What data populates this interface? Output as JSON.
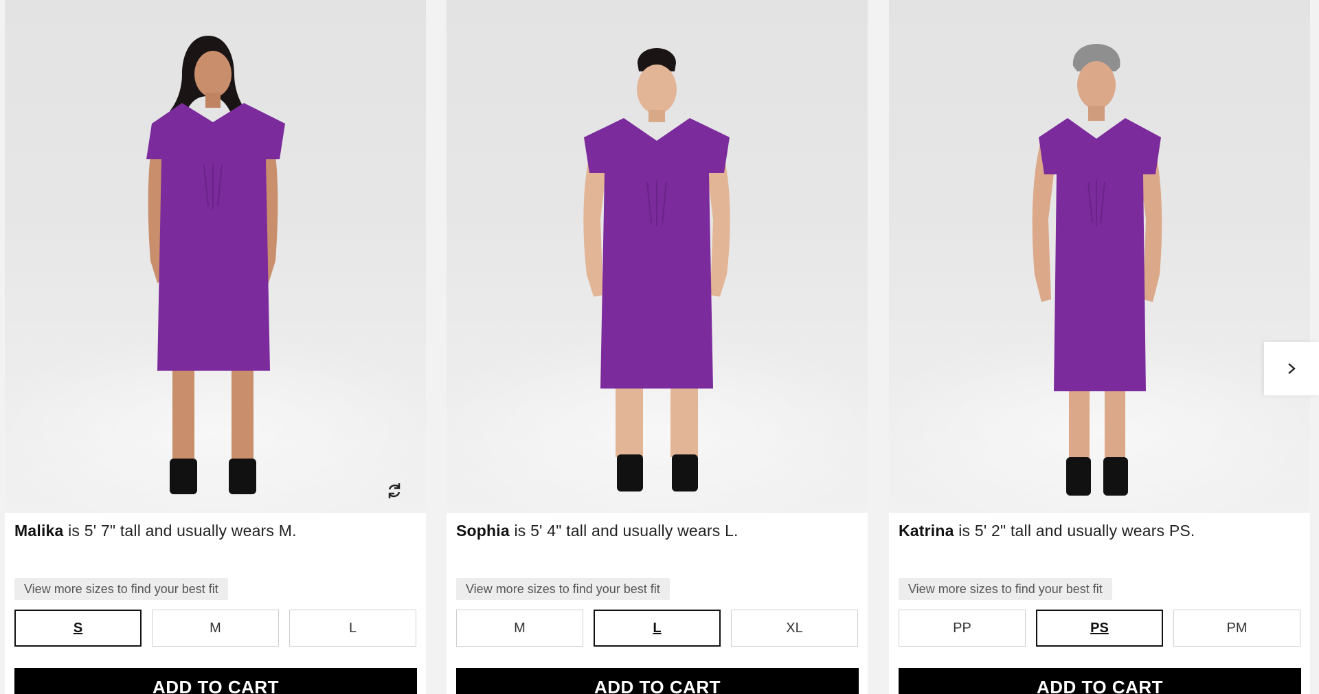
{
  "cards": [
    {
      "name": "Malika",
      "caption_rest": " is 5' 7\" tall and usually wears M.",
      "hint": "View more sizes to find your best fit",
      "sizes": [
        "S",
        "M",
        "L"
      ],
      "selected_size": "S",
      "cart_label": "ADD TO CART"
    },
    {
      "name": "Sophia",
      "caption_rest": " is 5' 4\" tall and usually wears L.",
      "hint": "View more sizes to find your best fit",
      "sizes": [
        "M",
        "L",
        "XL"
      ],
      "selected_size": "L",
      "cart_label": "ADD TO CART"
    },
    {
      "name": "Katrina",
      "caption_rest": " is 5' 2\" tall and usually wears PS.",
      "hint": "View more sizes to find your best fit",
      "sizes": [
        "PP",
        "PS",
        "PM"
      ],
      "selected_size": "PS",
      "cart_label": "ADD TO CART"
    }
  ],
  "icons": {
    "swap": "swap-model-icon",
    "next": "chevron-right-icon"
  },
  "colors": {
    "dress": "#7b2b9c",
    "cart_bg": "#000000",
    "hint_bg": "#ededed"
  }
}
